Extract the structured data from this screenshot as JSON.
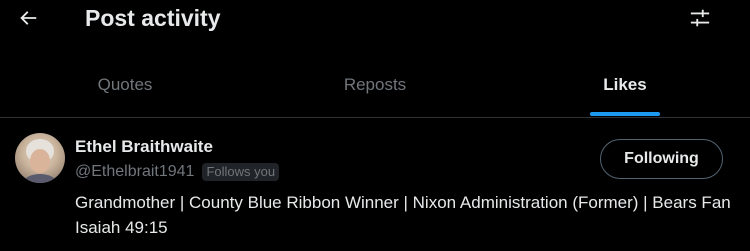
{
  "header": {
    "title": "Post activity",
    "back_icon": "arrow-left-icon",
    "settings_icon": "sliders-icon"
  },
  "tabs": [
    {
      "label": "Quotes",
      "active": false
    },
    {
      "label": "Reposts",
      "active": false
    },
    {
      "label": "Likes",
      "active": true
    }
  ],
  "user": {
    "display_name": "Ethel Braithwaite",
    "handle": "@Ethelbrait1941",
    "follows_you_badge": "Follows you",
    "follow_button_label": "Following",
    "bio": "Grandmother | County Blue Ribbon Winner | Nixon Administration (Former) | Bears Fan Isaiah 49:15"
  },
  "colors": {
    "background": "#000000",
    "text_primary": "#e7e9ea",
    "text_secondary": "#71767b",
    "accent": "#1d9bf0",
    "divider": "#2f3336"
  }
}
